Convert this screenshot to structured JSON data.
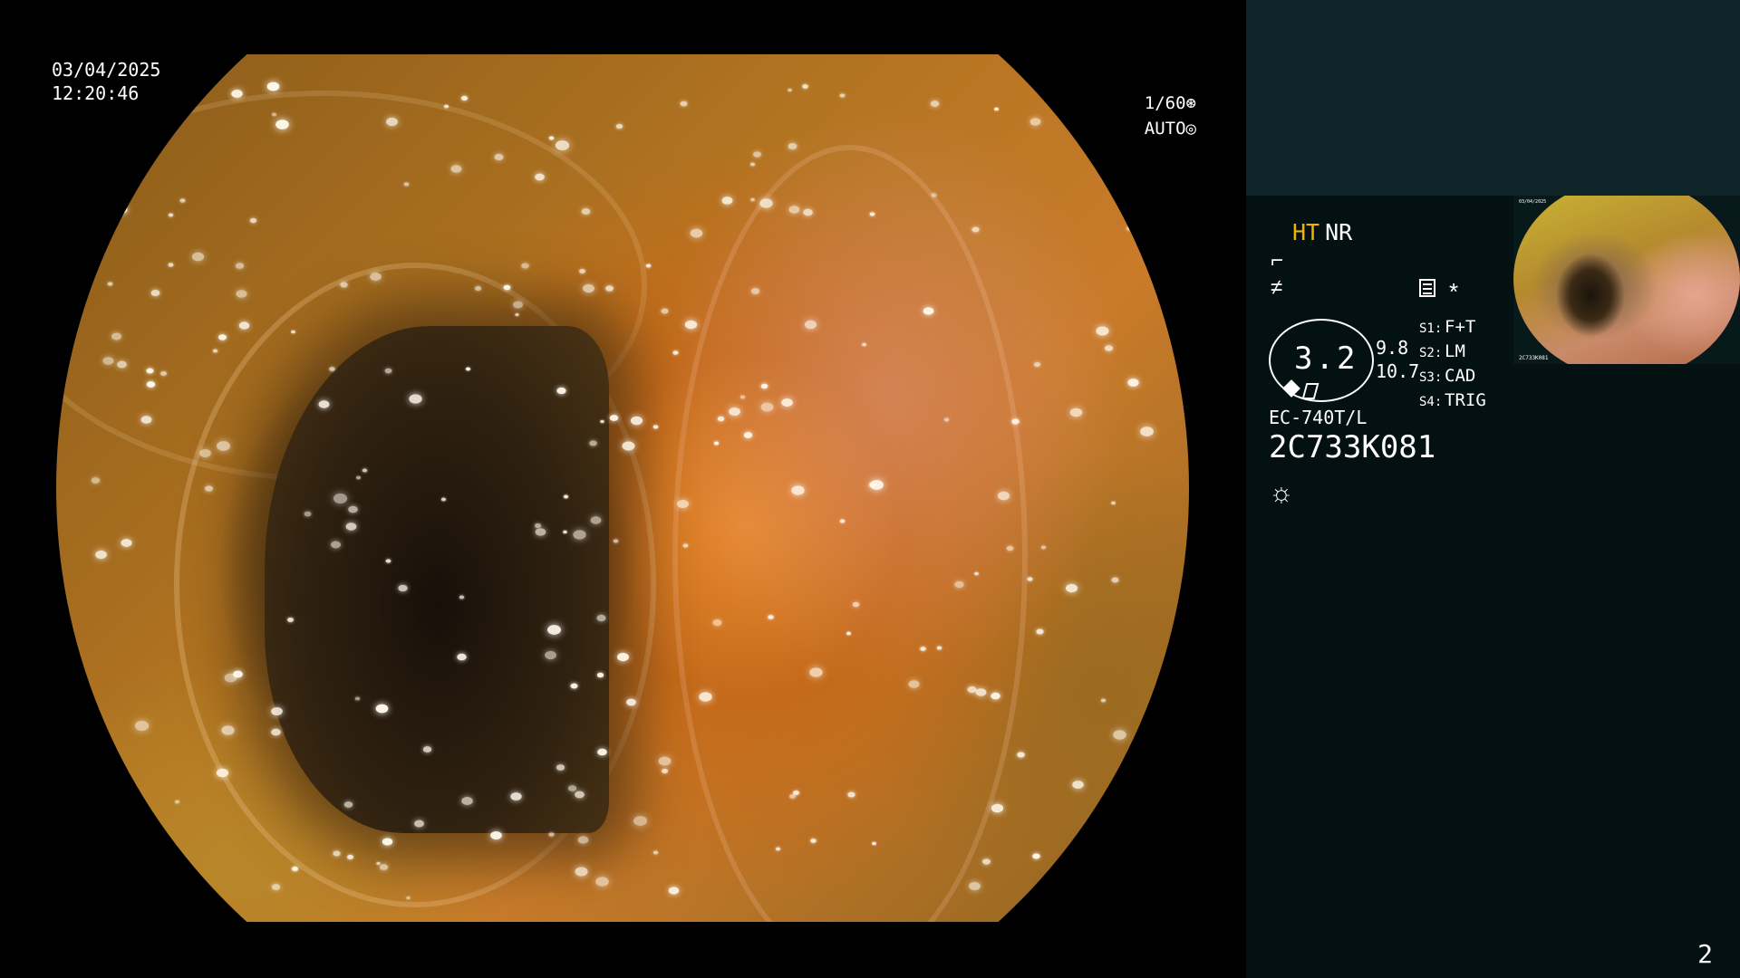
{
  "overlay": {
    "date": "03/04/2025",
    "time": "12:20:46",
    "shutter": "1/60",
    "iris": "AUTO"
  },
  "panel": {
    "mode_ht": "HT",
    "mode_nr": "NR",
    "zoom": "3.2",
    "scale_top": "9.8",
    "scale_bottom": "10.7",
    "switches": [
      {
        "key": "S1:",
        "value": "F+T"
      },
      {
        "key": "S2:",
        "value": "LM"
      },
      {
        "key": "S3:",
        "value": "CAD"
      },
      {
        "key": "S4:",
        "value": "TRIG"
      }
    ],
    "scope_model": "EC-740T/L",
    "scope_serial": "2C733K081"
  },
  "thumbnail": {
    "date": "03/04/2025",
    "serial": "2C733K081"
  },
  "page_number": "2",
  "colors": {
    "panel_top": "#0d2428",
    "panel_bottom": "#041112",
    "ht_accent": "#f3b200"
  },
  "icons": {
    "shutter": "aperture-icon",
    "iris": "iris-icon",
    "structure": "structure-enhance-icon",
    "color": "color-enhance-icon",
    "menu": "menu-icon",
    "star": "asterisk-icon",
    "light": "light-source-icon"
  }
}
